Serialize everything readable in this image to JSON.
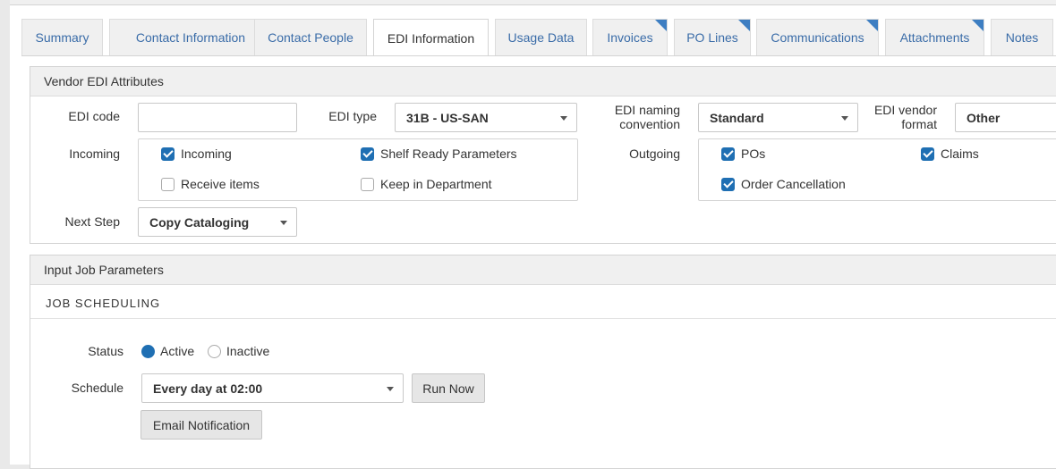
{
  "tabs": [
    {
      "label": "Summary",
      "active": false,
      "note": false
    },
    {
      "label": "Contact Information",
      "active": false,
      "note": false
    },
    {
      "label": "Contact People",
      "active": false,
      "note": false
    },
    {
      "label": "EDI Information",
      "active": true,
      "note": false
    },
    {
      "label": "Usage Data",
      "active": false,
      "note": false
    },
    {
      "label": "Invoices",
      "active": false,
      "note": true
    },
    {
      "label": "PO Lines",
      "active": false,
      "note": true
    },
    {
      "label": "Communications",
      "active": false,
      "note": true
    },
    {
      "label": "Attachments",
      "active": false,
      "note": true
    },
    {
      "label": "Notes",
      "active": false,
      "note": false
    }
  ],
  "edi_section": {
    "title": "Vendor EDI Attributes",
    "edi_code": {
      "label": "EDI code",
      "value": ""
    },
    "edi_type": {
      "label": "EDI type",
      "value": "31B - US-SAN"
    },
    "edi_naming": {
      "label_line1": "EDI naming",
      "label_line2": "convention",
      "value": "Standard"
    },
    "edi_vendor_format": {
      "label_line1": "EDI vendor",
      "label_line2": "format",
      "value": "Other"
    },
    "incoming": {
      "label": "Incoming",
      "options": [
        {
          "label": "Incoming",
          "checked": true
        },
        {
          "label": "Shelf Ready Parameters",
          "checked": true
        },
        {
          "label": "Receive items",
          "checked": false
        },
        {
          "label": "Keep in Department",
          "checked": false
        }
      ]
    },
    "outgoing": {
      "label": "Outgoing",
      "options": [
        {
          "label": "POs",
          "checked": true
        },
        {
          "label": "Claims",
          "checked": true
        },
        {
          "label": "Order Cancellation",
          "checked": true
        }
      ]
    },
    "next_step": {
      "label": "Next Step",
      "value": "Copy Cataloging"
    }
  },
  "job_section": {
    "title": "Input Job Parameters",
    "subheader": "JOB SCHEDULING",
    "status": {
      "label": "Status",
      "options": [
        {
          "label": "Active",
          "selected": true
        },
        {
          "label": "Inactive",
          "selected": false
        }
      ]
    },
    "schedule": {
      "label": "Schedule",
      "value": "Every day at 02:00"
    },
    "run_now_label": "Run Now",
    "email_notification_label": "Email Notification"
  },
  "colors": {
    "accent": "#1f6fb3",
    "tab_text": "#3a6ca8",
    "note_corner": "#3d7ec2"
  }
}
